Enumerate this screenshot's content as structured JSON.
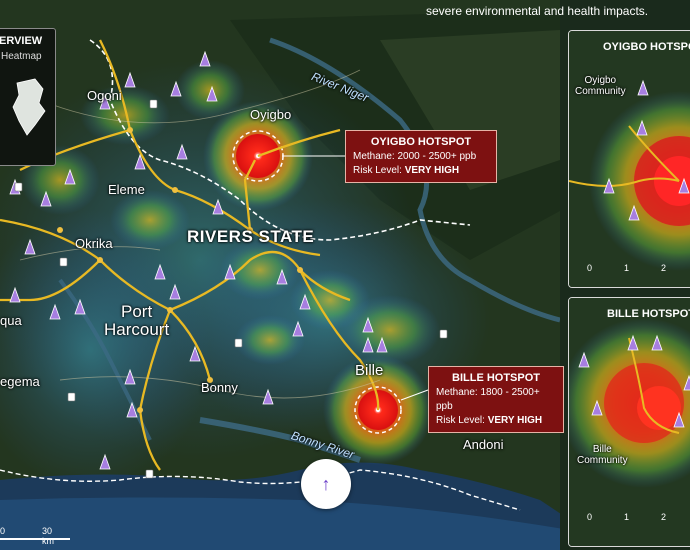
{
  "header": {
    "description": "severe environmental and health impacts."
  },
  "overview": {
    "title": "ERVIEW",
    "subtitle": "Heatmap"
  },
  "map": {
    "state_label": "RIVERS STATE",
    "towns": {
      "ogoni": "Ogoni",
      "oyigbo": "Oyigbo",
      "eleme": "Eleme",
      "okrika": "Okrika",
      "port_harcourt_line1": "Port",
      "port_harcourt_line2": "Harcourt",
      "bonny": "Bonny",
      "bille": "Bille",
      "andoni": "Andoni",
      "egema": "egema",
      "qua": "qua"
    },
    "rivers": {
      "niger": "River Niger",
      "bonny": "Bonny River"
    },
    "scale": {
      "label": "30 km",
      "zero": "0"
    }
  },
  "callouts": {
    "oyigbo": {
      "title": "OYIGBO HOTSPOT",
      "methane": "Methane: 2000 - 2500+ ppb",
      "risk_prefix": "Risk Level:",
      "risk_value": "VERY HIGH"
    },
    "bille": {
      "title": "BILLE HOTSPOT",
      "methane": "Methane: 1800 - 2500+ ppb",
      "risk_prefix": "Risk Level:",
      "risk_value": "VERY HIGH"
    }
  },
  "insets": {
    "oyigbo": {
      "title": "OYIGBO HOTSPOT",
      "community_line1": "Oyigbo",
      "community_line2": "Community",
      "ticks": [
        "0",
        "1",
        "2"
      ]
    },
    "bille": {
      "title": "BILLE HOTSPOT",
      "community_line1": "Bille",
      "community_line2": "Community",
      "ticks": [
        "0",
        "1",
        "2"
      ]
    }
  },
  "controls": {
    "scroll_up": "↑"
  },
  "colors": {
    "callout_bg": "#7d1111",
    "pipeline": "#e8b923",
    "facility": "#a77ee0",
    "hotspot": "#ff2a1a"
  }
}
